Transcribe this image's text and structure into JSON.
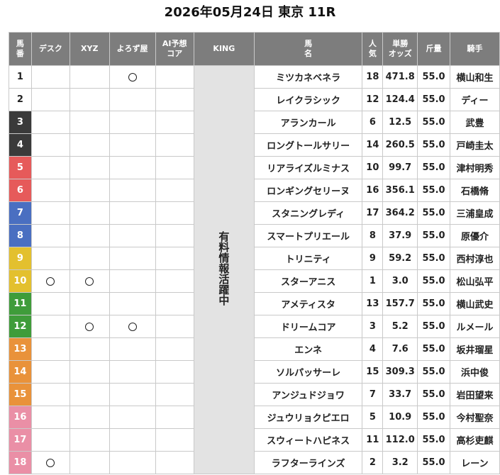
{
  "page_title": "2026年05月24日 東京 11R",
  "headers": {
    "num": "馬\n番",
    "desk": "デスク",
    "xyz": "XYZ",
    "yorozuya": "よろず屋",
    "ai": "AI予想\nコア",
    "king": "KING",
    "horse": "馬\n名",
    "pop": "人\n気",
    "odds": "単勝\nオッズ",
    "weight": "斤量",
    "jockey": "騎手"
  },
  "king_text": "有料情報活躍中",
  "mark_symbol": "circle",
  "frame_colors": {
    "1": "#ffffff",
    "2": "#ffffff",
    "3": "#3a3a3a",
    "4": "#3a3a3a",
    "5": "#e65a5a",
    "6": "#e65a5a",
    "7": "#4a6fc1",
    "8": "#4a6fc1",
    "9": "#e3c02e",
    "10": "#e3c02e",
    "11": "#3f9c3a",
    "12": "#3f9c3a",
    "13": "#e9923a",
    "14": "#e9923a",
    "15": "#e9923a",
    "16": "#ea8fa6",
    "17": "#ea8fa6",
    "18": "#ea8fa6"
  },
  "rows": [
    {
      "num": "1",
      "desk": false,
      "xyz": false,
      "yorozuya": true,
      "ai": false,
      "horse": "ミツカネベネラ",
      "pop": "18",
      "odds": "471.8",
      "weight": "55.0",
      "jockey": "横山和生"
    },
    {
      "num": "2",
      "desk": false,
      "xyz": false,
      "yorozuya": false,
      "ai": false,
      "horse": "レイクラシック",
      "pop": "12",
      "odds": "124.4",
      "weight": "55.0",
      "jockey": "ディー"
    },
    {
      "num": "3",
      "desk": false,
      "xyz": false,
      "yorozuya": false,
      "ai": false,
      "horse": "アランカール",
      "pop": "6",
      "odds": "12.5",
      "weight": "55.0",
      "jockey": "武豊"
    },
    {
      "num": "4",
      "desk": false,
      "xyz": false,
      "yorozuya": false,
      "ai": false,
      "horse": "ロングトールサリー",
      "pop": "14",
      "odds": "260.5",
      "weight": "55.0",
      "jockey": "戸崎圭太"
    },
    {
      "num": "5",
      "desk": false,
      "xyz": false,
      "yorozuya": false,
      "ai": false,
      "horse": "リアライズルミナス",
      "pop": "10",
      "odds": "99.7",
      "weight": "55.0",
      "jockey": "津村明秀"
    },
    {
      "num": "6",
      "desk": false,
      "xyz": false,
      "yorozuya": false,
      "ai": false,
      "horse": "ロンギングセリーヌ",
      "pop": "16",
      "odds": "356.1",
      "weight": "55.0",
      "jockey": "石橋脩"
    },
    {
      "num": "7",
      "desk": false,
      "xyz": false,
      "yorozuya": false,
      "ai": false,
      "horse": "スタニングレディ",
      "pop": "17",
      "odds": "364.2",
      "weight": "55.0",
      "jockey": "三浦皇成"
    },
    {
      "num": "8",
      "desk": false,
      "xyz": false,
      "yorozuya": false,
      "ai": false,
      "horse": "スマートプリエール",
      "pop": "8",
      "odds": "37.9",
      "weight": "55.0",
      "jockey": "原優介"
    },
    {
      "num": "9",
      "desk": false,
      "xyz": false,
      "yorozuya": false,
      "ai": false,
      "horse": "トリニティ",
      "pop": "9",
      "odds": "59.2",
      "weight": "55.0",
      "jockey": "西村淳也"
    },
    {
      "num": "10",
      "desk": true,
      "xyz": true,
      "yorozuya": false,
      "ai": false,
      "horse": "スターアニス",
      "pop": "1",
      "odds": "3.0",
      "weight": "55.0",
      "jockey": "松山弘平"
    },
    {
      "num": "11",
      "desk": false,
      "xyz": false,
      "yorozuya": false,
      "ai": false,
      "horse": "アメティスタ",
      "pop": "13",
      "odds": "157.7",
      "weight": "55.0",
      "jockey": "横山武史"
    },
    {
      "num": "12",
      "desk": false,
      "xyz": true,
      "yorozuya": true,
      "ai": false,
      "horse": "ドリームコア",
      "pop": "3",
      "odds": "5.2",
      "weight": "55.0",
      "jockey": "ルメール"
    },
    {
      "num": "13",
      "desk": false,
      "xyz": false,
      "yorozuya": false,
      "ai": false,
      "horse": "エンネ",
      "pop": "4",
      "odds": "7.6",
      "weight": "55.0",
      "jockey": "坂井瑠星"
    },
    {
      "num": "14",
      "desk": false,
      "xyz": false,
      "yorozuya": false,
      "ai": false,
      "horse": "ソルパッサーレ",
      "pop": "15",
      "odds": "309.3",
      "weight": "55.0",
      "jockey": "浜中俊"
    },
    {
      "num": "15",
      "desk": false,
      "xyz": false,
      "yorozuya": false,
      "ai": false,
      "horse": "アンジュドジョワ",
      "pop": "7",
      "odds": "33.7",
      "weight": "55.0",
      "jockey": "岩田望来"
    },
    {
      "num": "16",
      "desk": false,
      "xyz": false,
      "yorozuya": false,
      "ai": false,
      "horse": "ジュウリョクピエロ",
      "pop": "5",
      "odds": "10.9",
      "weight": "55.0",
      "jockey": "今村聖奈"
    },
    {
      "num": "17",
      "desk": false,
      "xyz": false,
      "yorozuya": false,
      "ai": false,
      "horse": "スウィートハピネス",
      "pop": "11",
      "odds": "112.0",
      "weight": "55.0",
      "jockey": "高杉吏麒"
    },
    {
      "num": "18",
      "desk": true,
      "xyz": false,
      "yorozuya": false,
      "ai": false,
      "horse": "ラフターラインズ",
      "pop": "2",
      "odds": "3.2",
      "weight": "55.0",
      "jockey": "レーン"
    }
  ]
}
